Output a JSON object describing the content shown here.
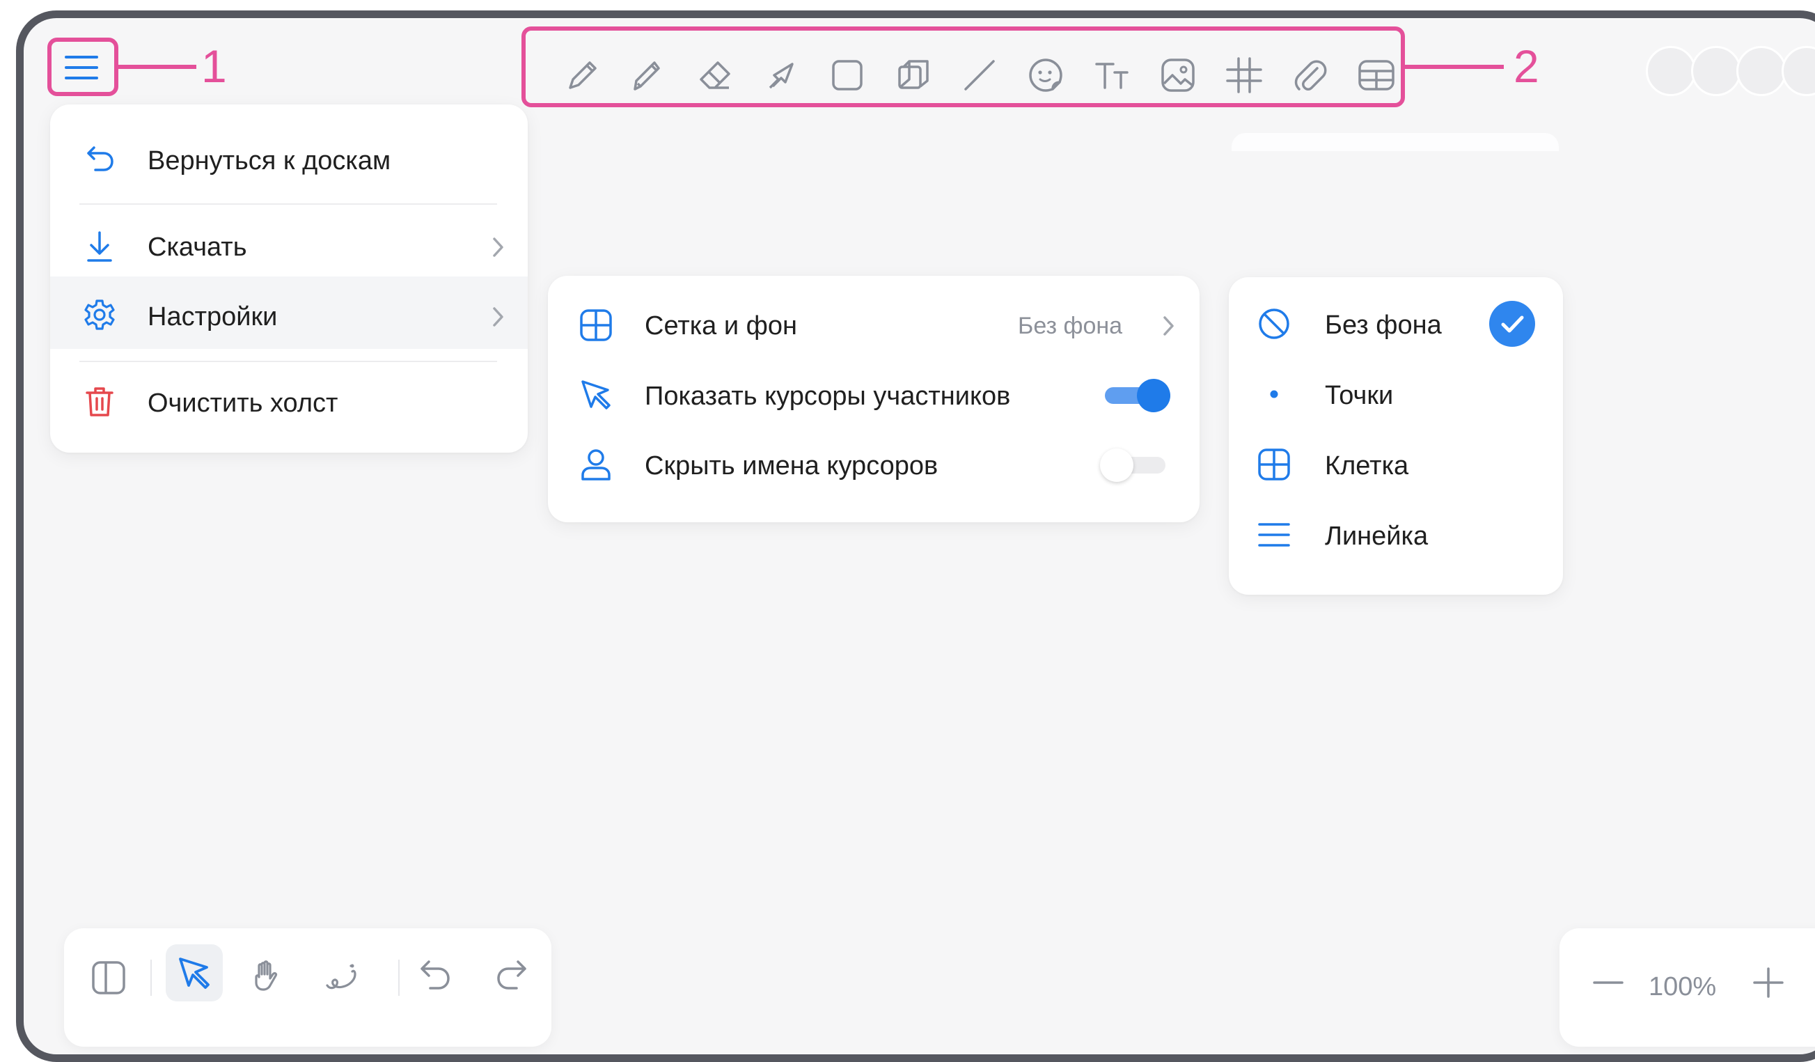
{
  "annotations": {
    "label_1": "1",
    "label_2": "2"
  },
  "toolbar": {
    "tools": [
      "pencil-icon",
      "marker-icon",
      "eraser-icon",
      "arrow-icon",
      "rectangle-icon",
      "shapes-icon",
      "line-icon",
      "sticker-icon",
      "text-icon",
      "image-icon",
      "grid-icon",
      "attachment-icon",
      "table-icon"
    ]
  },
  "main_menu": {
    "back": "Вернуться к доскам",
    "download": "Скачать",
    "settings": "Настройки",
    "clear": "Очистить холст"
  },
  "settings_menu": {
    "grid_background": "Сетка и фон",
    "grid_background_value": "Без фона",
    "show_cursors": "Показать курсоры участников",
    "show_cursors_on": true,
    "hide_cursor_names": "Скрыть имена курсоров",
    "hide_cursor_names_on": false
  },
  "background_menu": {
    "options": [
      "Без фона",
      "Точки",
      "Клетка",
      "Линейка"
    ],
    "selected": "Без фона"
  },
  "zoom": {
    "level": "100%"
  },
  "colors": {
    "accent": "#1f7be9",
    "highlight": "#e4509a",
    "danger": "#e5484d",
    "icon_gray": "#8a8f99"
  }
}
